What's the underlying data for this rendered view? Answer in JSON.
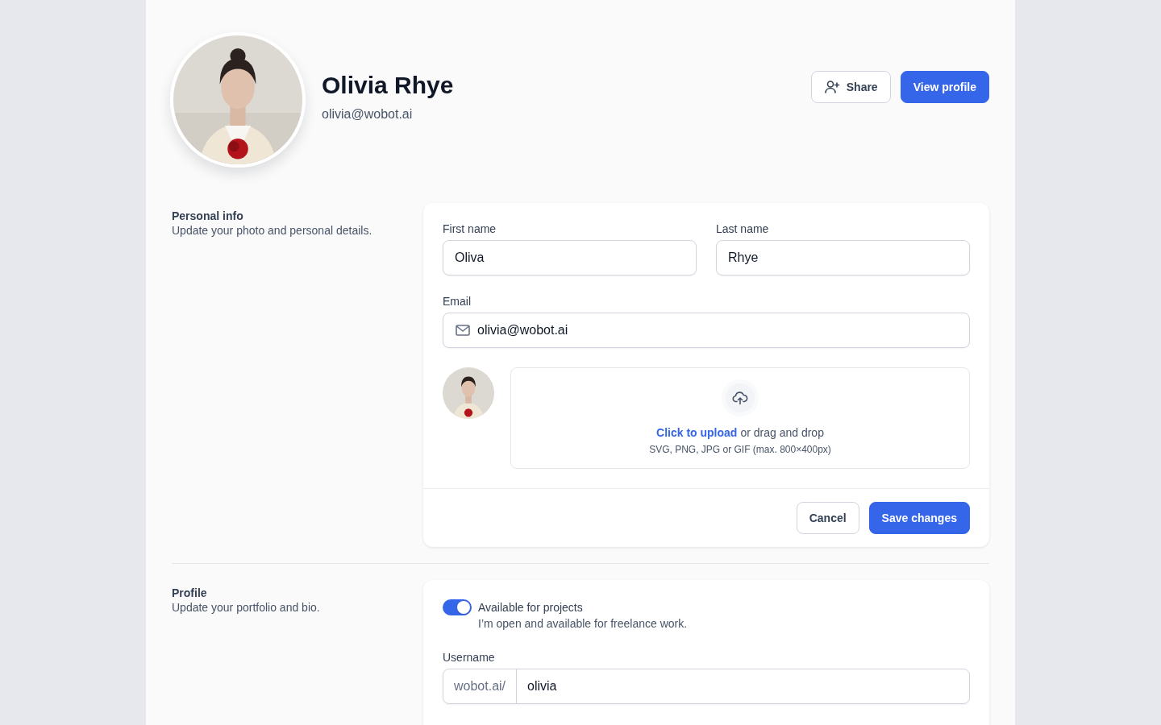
{
  "profile": {
    "name": "Olivia Rhye",
    "email": "olivia@wobot.ai"
  },
  "header_buttons": [
    {
      "label": "Share",
      "kind": "secondary"
    },
    {
      "label": "View profile",
      "kind": "primary"
    }
  ],
  "personal_info": {
    "title": "Personal info",
    "description": "Update your photo and personal details.",
    "name_fields": [
      {
        "label": "First name",
        "value": "Oliva"
      },
      {
        "label": "Last name",
        "value": "Rhye"
      }
    ],
    "email_field": {
      "label": "Email",
      "value": "olivia@wobot.ai"
    },
    "upload": {
      "link": "Click to upload",
      "text": "or drag and drop",
      "hint": "SVG, PNG, JPG or GIF (max. 800×400px)"
    },
    "actions": [
      {
        "label": "Cancel",
        "kind": "secondary"
      },
      {
        "label": "Save changes",
        "kind": "primary"
      }
    ]
  },
  "profile_section": {
    "title": "Profile",
    "description": "Update your portfolio and bio.",
    "availability": {
      "label": "Available for projects",
      "description": "I’m open and available for freelance work.",
      "on": true
    },
    "username": {
      "label": "Username",
      "prefix": "wobot.ai/",
      "value": "olivia"
    }
  }
}
